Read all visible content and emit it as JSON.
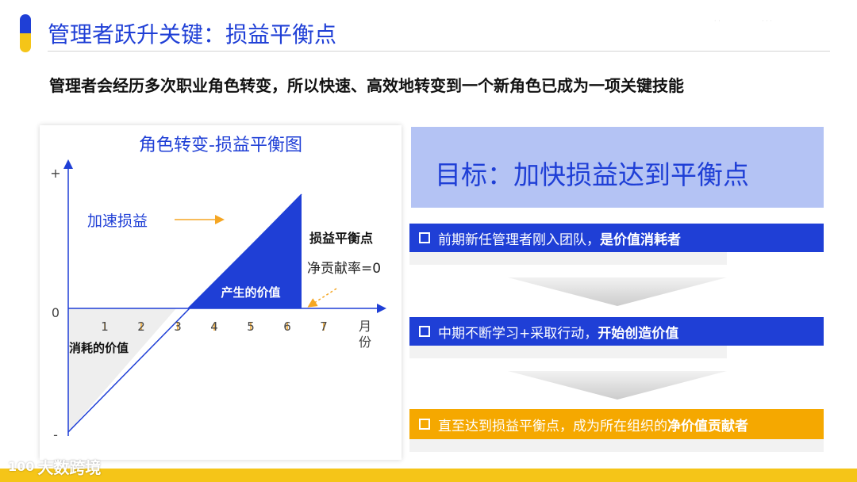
{
  "header": {
    "title": "管理者跃升关键：损益平衡点",
    "subtitle": "管理者会经历多次职业角色转变，所以快速、高效地转变到一个新角色已成为一项关键技能"
  },
  "chart": {
    "title": "角色转变-损益平衡图",
    "y_plus": "+",
    "y_zero": "0",
    "y_minus": "-",
    "x_ticks": [
      "1",
      "2",
      "3",
      "4",
      "5",
      "6",
      "7"
    ],
    "x_unit_line1": "月",
    "x_unit_line2": "份",
    "label_accelerate": "加速损益",
    "label_value_created": "产生的价值",
    "label_value_consumed": "消耗的价值",
    "label_breakeven": "损益平衡点",
    "label_net_contribution": "净贡献率=0"
  },
  "goal": {
    "text": "目标：加快损益达到平衡点"
  },
  "steps": [
    {
      "normal": "前期新任管理者刚入团队，",
      "bold": "是价值消耗者"
    },
    {
      "normal": "中期不断学习+采取行动，",
      "bold": "开始创造价值"
    },
    {
      "normal": "直至达到损益平衡点，成为所在组织的",
      "bold": "净价值贡献者"
    }
  ],
  "footer": {
    "logo_mark": "100",
    "logo_text": "大数跨境"
  },
  "colors": {
    "primary_blue": "#1f3fd6",
    "light_blue": "#b4c3f4",
    "accent_yellow": "#f5c518",
    "accent_orange": "#f5a800",
    "arrow_orange": "#f5a623",
    "consumed_fill": "#eeeeee"
  }
}
